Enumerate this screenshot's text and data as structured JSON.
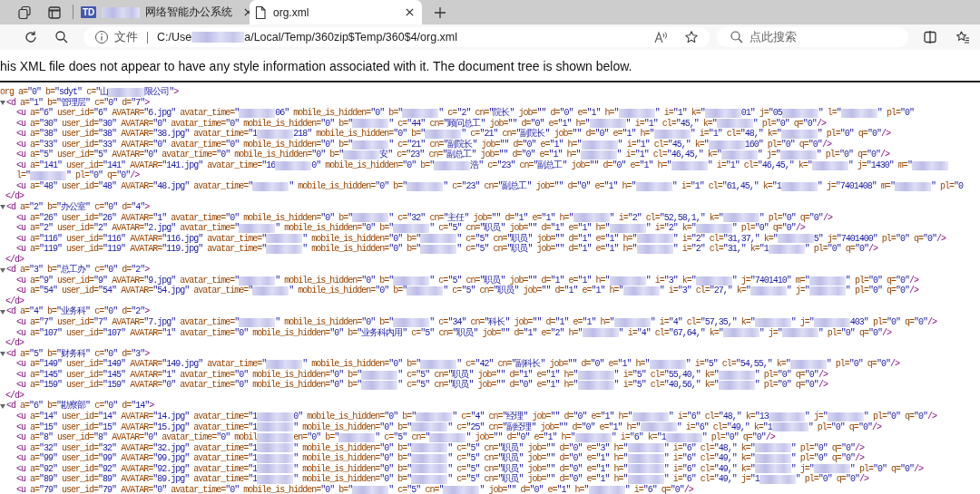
{
  "tabs": [
    {
      "favicon": "TD",
      "title": [
        "网络智能办公系统"
      ],
      "redacted": true,
      "selected": false
    },
    {
      "title": [
        "org.xml"
      ],
      "redacted": false,
      "selected": true
    }
  ],
  "address_bar": {
    "label": "文件",
    "url": [
      "C:/Use",
      {
        "kind": "redacted"
      },
      "a/Local/Temp/360zip$Temp/360$4/org.xml"
    ]
  },
  "search": {
    "placeholder": "点此搜索"
  },
  "notice": "his XML file does not appear to have any style information associated with it. The document tree is shown below.",
  "document": {
    "open_tag": [
      [
        "org a=\"0\" b=\"sdyt\" c=\"山",
        {
          "kind": "redacted"
        },
        "限公司\">"
      ]
    ],
    "children": [
      {
        "expanded": true,
        "open_tag": [
          [
            "<d a=\"1\" b=\"管理层\" c=\"0\" d=\"7\">"
          ]
        ],
        "close_tag": [
          [
            "</d>"
          ]
        ],
        "children": [
          {
            "lines": [
              [
                "<u a=\"6\" user_id=\"6\" AVATAR=\"6.jpg\" avatar_time=\"",
                {
                  "kind": "redacted"
                },
                "06\" mobile_is_hidden=\"0\" b=\"",
                {
                  "kind": "redacted"
                },
                "\" c=\"2\" cn=\"院长\" job=\"\" d=\"0\" e=\"1\" h=\"",
                {
                  "kind": "redacted"
                },
                "\" i=\"1\" k=\"",
                {
                  "kind": "redacted"
                },
                "01\" j=\"05",
                {
                  "kind": "redacted"
                },
                "\" l=\"",
                {
                  "kind": "redacted"
                },
                "\" pl=\"0\""
              ]
            ]
          },
          {
            "lines": [
              [
                "<u a=\"30\" user_id=\"30\" AVATAR=\"0\" avatar_time=\"0\" mobile_is_hidden=\"0\" b=\"",
                {
                  "kind": "redacted"
                },
                "\" c=\"44\" cn=\"顾问总工\" job=\"\" d=\"0\" e=\"1\" h=\"",
                {
                  "kind": "redacted"
                },
                "\" i=\"1\" cl=\"45,\" k=\"",
                {
                  "kind": "redacted"
                },
                "\" pl=\"0\" q=\"0\"/>"
              ]
            ]
          },
          {
            "lines": [
              [
                "<u a=\"38\" user_id=\"38\" AVATAR=\"38.jpg\" avatar_time=\"1",
                {
                  "kind": "redacted"
                },
                "218\" mobile_is_hidden=\"0\" b=\"",
                {
                  "kind": "redacted"
                },
                "\" c=\"21\" cn=\"副院长\" job=\"\" d=\"0\" e=\"1\" h=\"",
                {
                  "kind": "redacted"
                },
                "\" i=\"1\" cl=\"48,\" k=\"",
                {
                  "kind": "redacted"
                },
                "\" pl=\"0\" q=\"0\"/>"
              ]
            ]
          },
          {
            "lines": [
              [
                "<u a=\"33\" user_id=\"33\" AVATAR=\"0\" avatar_time=\"0\" mobile_is_hidden=\"0\" b=\"",
                {
                  "kind": "redacted"
                },
                "\" c=\"21\" cn=\"副院长\" job=\"\" d=\"0\" e=\"1\" h=\"",
                {
                  "kind": "redacted"
                },
                "\" i=\"1\" cl=\"45,\" k=\"",
                {
                  "kind": "redacted"
                },
                "160\" pl=\"0\" q=\"0\"/>"
              ]
            ]
          },
          {
            "lines": [
              [
                "<u a=\"5\" user_id=\"5\" AVATAR=\"0\" avatar_time=\"0\" mobile_is_hidden=\"0\" b=\"",
                {
                  "kind": "redacted"
                },
                "安\" c=\"23\" cn=\"副总工\" job=\"\" d=\"0\" e=\"1\" h=\"",
                {
                  "kind": "redacted"
                },
                "\" i=\"1\" cl=\"46,45,\" k=\"",
                {
                  "kind": "redacted"
                },
                "\" j=\"",
                {
                  "kind": "redacted"
                },
                "\" pl=\"0\" q=\"0\"/>"
              ]
            ]
          },
          {
            "lines": [
              [
                "<u a=\"141\" user_id=\"141\" AVATAR=\"141.jpg\" avatar_time=\"16",
                {
                  "kind": "redacted"
                },
                "0\" mobile_is_hidden=\"0\" b=\"",
                {
                  "kind": "redacted"
                },
                "浩\" c=\"23\" cn=\"副总工\" job=\"\" d=\"0\" e=\"1\" h=\"",
                {
                  "kind": "redacted"
                },
                "\" i=\"1\" cl=\"46,45,\" k=\"",
                {
                  "kind": "redacted"
                },
                "\" j=\"1430\" m=\"",
                {
                  "kind": "redacted"
                }
              ],
              [
                "l=\"",
                {
                  "kind": "redacted"
                },
                "\" pl=\"0\" q=\"0\"/>"
              ]
            ]
          },
          {
            "lines": [
              [
                "<u a=\"48\" user_id=\"48\" AVATAR=\"48.jpg\" avatar_time=\"",
                {
                  "kind": "redacted"
                },
                "\" mobile_is_hidden=\"0\" b=\"",
                {
                  "kind": "redacted"
                },
                "\" c=\"23\" cn=\"副总工\" job=\"\" d=\"0\" e=\"1\" h=\"",
                {
                  "kind": "redacted"
                },
                "\" i=\"1\" cl=\"61,45,\" k=\"1",
                {
                  "kind": "redacted"
                },
                "\" j=\"7401408\" m=\"",
                {
                  "kind": "redacted"
                },
                "\" pl=\"0"
              ]
            ]
          }
        ]
      },
      {
        "expanded": true,
        "open_tag": [
          [
            "<d a=\"2\" b=\"办公室\" c=\"0\" d=\"4\">"
          ]
        ],
        "close_tag": [
          [
            "</d>"
          ]
        ],
        "children": [
          {
            "lines": [
              [
                "<u a=\"26\" user_id=\"26\" AVATAR=\"1\" avatar_time=\"0\" mobile_is_hidden=\"0\" b=\"",
                {
                  "kind": "redacted"
                },
                "\" c=\"32\" cn=\"主任\" job=\"\" d=\"1\" e=\"1\" h=\"",
                {
                  "kind": "redacted"
                },
                "\" i=\"2\" cl=\"52,58,1,\" k=\"",
                {
                  "kind": "redacted"
                },
                "\" pl=\"0\" q=\"0\"/>"
              ]
            ]
          },
          {
            "lines": [
              [
                "<u a=\"2\" user_id=\"2\" AVATAR=\"2.jpg\" avatar_time=\"",
                {
                  "kind": "redacted"
                },
                "\" mobile_is_hidden=\"0\" b=\"",
                {
                  "kind": "redacted"
                },
                "\" c=\"5\" cn=\"职员\" job=\"\" d=\"1\" e=\"1\" h=\"",
                {
                  "kind": "redacted"
                },
                "\" i=\"2\" k=\"",
                {
                  "kind": "redacted"
                },
                "\" pl=\"0\" q=\"0\"/>"
              ]
            ]
          },
          {
            "lines": [
              [
                "<u a=\"116\" user_id=\"116\" AVATAR=\"116.jpg\" avatar_time=\"",
                {
                  "kind": "redacted"
                },
                "\" mobile_is_hidden=\"0\" b=\"",
                {
                  "kind": "redacted"
                },
                "\" c=\"5\" cn=\"职员\" job=\"\" d=\"1\" e=\"1\" h=\"",
                {
                  "kind": "redacted"
                },
                "\" i=\"2\" cl=\"31,37,\" k=\"",
                {
                  "kind": "redacted"
                },
                "5\" j=\"7401400\" pl=\"0\" q=\"0\"/>"
              ]
            ]
          },
          {
            "lines": [
              [
                "<u a=\"119\" user_id=\"119\" AVATAR=\"119.jpg\" avatar_time=\"",
                {
                  "kind": "redacted"
                },
                "\" mobile_is_hidden=\"0\" b=\"",
                {
                  "kind": "redacted"
                },
                "\" c=\"5\" cn=\"职员\" job=\"\" d=\"1\" e=\"1\" h=\"",
                {
                  "kind": "redacted"
                },
                "\" i=\"2\" cl=\"31,\" k=\"1",
                {
                  "kind": "redacted"
                },
                "\" pl=\"0\" q=\"0\"/>"
              ]
            ]
          }
        ]
      },
      {
        "expanded": true,
        "open_tag": [
          [
            "<d a=\"3\" b=\"总工办\" c=\"0\" d=\"2\">"
          ]
        ],
        "close_tag": [
          [
            "</d>"
          ]
        ],
        "children": [
          {
            "lines": [
              [
                "<u a=\"9\" user_id=\"9\" AVATAR=\"9.jpg\" avatar_time=\"",
                {
                  "kind": "redacted"
                },
                "\" mobile_is_hidden=\"0\" b=\"",
                {
                  "kind": "redacted"
                },
                "\" c=\"5\" cn=\"职员\" job=\"\" d=\"1\" e=\"1\" h=\"",
                {
                  "kind": "redacted"
                },
                "\" i=\"3\" k=\"",
                {
                  "kind": "redacted"
                },
                "\" j=\"7401410\" m=\"",
                {
                  "kind": "redacted"
                },
                "\" pl=\"0\" q=\"0\"/>"
              ]
            ]
          },
          {
            "lines": [
              [
                "<u a=\"54\" user_id=\"54\" AVATAR=\"54.jpg\" avatar_time=\"",
                {
                  "kind": "redacted"
                },
                "\" mobile_is_hidden=\"0\" b=\"",
                {
                  "kind": "redacted"
                },
                "\" c=\"5\" cn=\"职员\" job=\"\" d=\"1\" e=\"1\" h=\"",
                {
                  "kind": "redacted"
                },
                "\" i=\"3\" cl=\"27,\" k=\"",
                {
                  "kind": "redacted"
                },
                "\" j=\"",
                {
                  "kind": "redacted"
                },
                "\" pl=\"0\" q=\"0\"/>"
              ]
            ]
          }
        ]
      },
      {
        "expanded": true,
        "open_tag": [
          [
            "<d a=\"4\" b=\"业务科\" c=\"0\" d=\"2\">"
          ]
        ],
        "close_tag": [
          [
            "</d>"
          ]
        ],
        "children": [
          {
            "lines": [
              [
                "<u a=\"7\" user_id=\"7\" AVATAR=\"7.jpg\" avatar_time=\"",
                {
                  "kind": "redacted"
                },
                "\" mobile_is_hidden=\"0\" b=\"",
                {
                  "kind": "redacted"
                },
                "\" c=\"34\" cn=\"科长\" job=\"\" d=\"1\" e=\"1\" h=\"",
                {
                  "kind": "redacted"
                },
                "\" i=\"4\" cl=\"57,35,\" k=\"",
                {
                  "kind": "redacted"
                },
                "\" j=\"",
                {
                  "kind": "redacted"
                },
                "403\" pl=\"0\" q=\"0\"/>"
              ]
            ]
          },
          {
            "lines": [
              [
                "<u a=\"107\" user_id=\"107\" AVATAR=\"1\" avatar_time=\"0\" mobile_is_hidden=\"0\" b=\"业务科内用\" c=\"5\" cn=\"职员\" job=\"\" d=\"1\" e=\"2\" h=\"",
                {
                  "kind": "redacted"
                },
                "\" i=\"4\" cl=\"67,64,\" k=\"",
                {
                  "kind": "redacted"
                },
                "\" j=\"",
                {
                  "kind": "redacted"
                },
                "\" pl=\"0\" q=\"0\"/>"
              ]
            ]
          }
        ]
      },
      {
        "expanded": true,
        "open_tag": [
          [
            "<d a=\"5\" b=\"财务科\" c=\"0\" d=\"3\">"
          ]
        ],
        "close_tag": [
          [
            "</d>"
          ]
        ],
        "children": [
          {
            "lines": [
              [
                "<u a=\"149\" user_id=\"149\" AVATAR=\"149.jpg\" avatar_time=\"",
                {
                  "kind": "redacted"
                },
                "\" mobile_is_hidden=\"0\" b=\"",
                {
                  "kind": "redacted"
                },
                "\" c=\"42\" cn=\"副科长\" job=\"\" d=\"0\" e=\"1\" h=\"",
                {
                  "kind": "redacted"
                },
                "\" i=\"5\" cl=\"54,55,\" k=\"",
                {
                  "kind": "redacted"
                },
                "\" pl=\"0\" q=\"0\"/>"
              ]
            ]
          },
          {
            "lines": [
              [
                "<u a=\"145\" user_id=\"145\" AVATAR=\"1\" avatar_time=\"0\" mobile_is_hidden=\"0\" b=\"",
                {
                  "kind": "redacted"
                },
                "\" c=\"5\" cn=\"职员\" job=\"\" d=\"1\" e=\"1\" h=\"",
                {
                  "kind": "redacted"
                },
                "\" i=\"5\" cl=\"55,40,\" k=\"",
                {
                  "kind": "redacted"
                },
                "\" pl=\"0\" q=\"0\"/>"
              ]
            ]
          },
          {
            "lines": [
              [
                "<u a=\"159\" user_id=\"159\" AVATAR=\"0\" avatar_time=\"0\" mobile_is_hidden=\"0\" b=\"",
                {
                  "kind": "redacted"
                },
                "\" c=\"5\" cn=\"职员\" job=\"\" d=\"0\" e=\"1\" h=\"",
                {
                  "kind": "redacted"
                },
                "\" i=\"5\" cl=\"40,56,\" k=\"",
                {
                  "kind": "redacted"
                },
                "\" pl=\"0\" q=\"0\"/>"
              ]
            ]
          }
        ]
      },
      {
        "expanded": true,
        "open_tag": [
          [
            "<d a=\"6\" b=\"勘察部\" c=\"0\" d=\"14\">"
          ]
        ],
        "children": [
          {
            "lines": [
              [
                "<u a=\"14\" user_id=\"14\" AVATAR=\"14.jpg\" avatar_time=\"1",
                {
                  "kind": "redacted"
                },
                "0\" mobile_is_hidden=\"0\" b=\"",
                {
                  "kind": "redacted"
                },
                "\" c=\"4\" cn=\"经理\" job=\"\" d=\"0\" e=\"1\" h=\"",
                {
                  "kind": "redacted"
                },
                "\" i=\"6\" cl=\"48,\" k=\"13",
                {
                  "kind": "redacted"
                },
                "\" j=\"",
                {
                  "kind": "redacted"
                },
                "\" pl=\"0\" q=\"0\"/>"
              ]
            ]
          },
          {
            "lines": [
              [
                "<u a=\"15\" user_id=\"15\" AVATAR=\"15.jpg\" avatar_time=\"1",
                {
                  "kind": "redacted"
                },
                "\" mobile_is_hidden=\"0\" b=\"",
                {
                  "kind": "redacted"
                },
                "\" c=\"25\" cn=\"副经理\" job=\"\" d=\"0\" e=\"1\" h=\"",
                {
                  "kind": "redacted"
                },
                "\" i=\"6\" cl=\"49,\" k=\"1",
                {
                  "kind": "redacted"
                },
                "\" pl=\"0\" q=\"0\"/>"
              ]
            ]
          },
          {
            "lines": [
              [
                "<u a=\"8\" user_id=\"8\" AVATAR=\"0\" avatar_time=\"0\" mobil",
                {
                  "kind": "redacted"
                },
                "en=\"0\" b=\"",
                {
                  "kind": "redacted"
                },
                "\" c=\"5\" cn=\"",
                {
                  "kind": "redacted"
                },
                "\" job=\"\" d=\"0\" e=\"1\" h=\"",
                {
                  "kind": "redacted"
                },
                "\" i=\"6\" k=\"1",
                {
                  "kind": "redacted"
                },
                "\" pl=\"0\" q=\"0\"/>"
              ]
            ]
          },
          {
            "lines": [
              [
                "<u a=\"32\" user_id=\"32\" AVATAR=\"32.jpg\" avatar_time=\"1",
                {
                  "kind": "redacted"
                },
                "\" mobile_is_hidden=\"0\" b=\"",
                {
                  "kind": "redacted"
                },
                "\" c=\"5\" cn=\"职员\" job=\"\" d=\"0\" e=\"3\" h=\"",
                {
                  "kind": "redacted"
                },
                "\" i=\"6\" cl=\"48,\" k=\"",
                {
                  "kind": "redacted"
                },
                "\" pl=\"0\" q=\"0\"/>"
              ]
            ]
          },
          {
            "lines": [
              [
                "<u a=\"99\" user_id=\"99\" AVATAR=\"99.jpg\" avatar_time=\"1",
                {
                  "kind": "redacted"
                },
                "\" mobile_is_hidden=\"0\" b=\"",
                {
                  "kind": "redacted"
                },
                "\" c=\"5\" cn=\"职员\" job=\"\" d=\"0\" e=\"1\" h=\"",
                {
                  "kind": "redacted"
                },
                "\" i=\"6\" cl=\"49,\" k=\"",
                {
                  "kind": "redacted"
                },
                "\" pl=\"0\" q=\"0\"/>"
              ]
            ]
          },
          {
            "lines": [
              [
                "<u a=\"92\" user_id=\"92\" AVATAR=\"92.jpg\" avatar_time=\"1",
                {
                  "kind": "redacted"
                },
                "\" mobile_is_hidden=\"0\" b=\"",
                {
                  "kind": "redacted"
                },
                "\" c=\"5\" cn=\"职员\" job=\"\" d=\"0\" e=\"1\" h=\"",
                {
                  "kind": "redacted"
                },
                "\" i=\"6\" cl=\"49,\" k=\"",
                {
                  "kind": "redacted"
                },
                "\" j=\"",
                {
                  "kind": "redacted"
                },
                "\" pl=\"0\" q=\"0\"/>"
              ]
            ]
          },
          {
            "lines": [
              [
                "<u a=\"89\" user_id=\"89\" AVATAR=\"89.jpg\" avatar_time=\"1",
                {
                  "kind": "redacted"
                },
                "\" mobile_is_hidden=\"0\" b=\"",
                {
                  "kind": "redacted"
                },
                "\" c=\"5\" cn=\"职员\" job=\"\" d=\"0\" e=\"1\" h=\"",
                {
                  "kind": "redacted"
                },
                "\" i=\"6\" cl=\"49,\" j=\"1",
                {
                  "kind": "redacted"
                },
                "\" pl=\"0\" q=\"0\"/>"
              ]
            ]
          },
          {
            "lines": [
              [
                "<u a=\"79\" user_id=\"79\" AVATAR=\"0\" avatar_time=\"0\" mobile_is_hidden=\"0\" b=\"",
                {
                  "kind": "redacted"
                },
                "\" c=\"5\" cn=\"",
                {
                  "kind": "redacted"
                },
                "\" job=\"\" d=\"0\" e=\"1\" h=\"",
                {
                  "kind": "redacted"
                },
                "\" i=\"6\" q=\"0\"/>"
              ]
            ]
          }
        ]
      }
    ]
  }
}
